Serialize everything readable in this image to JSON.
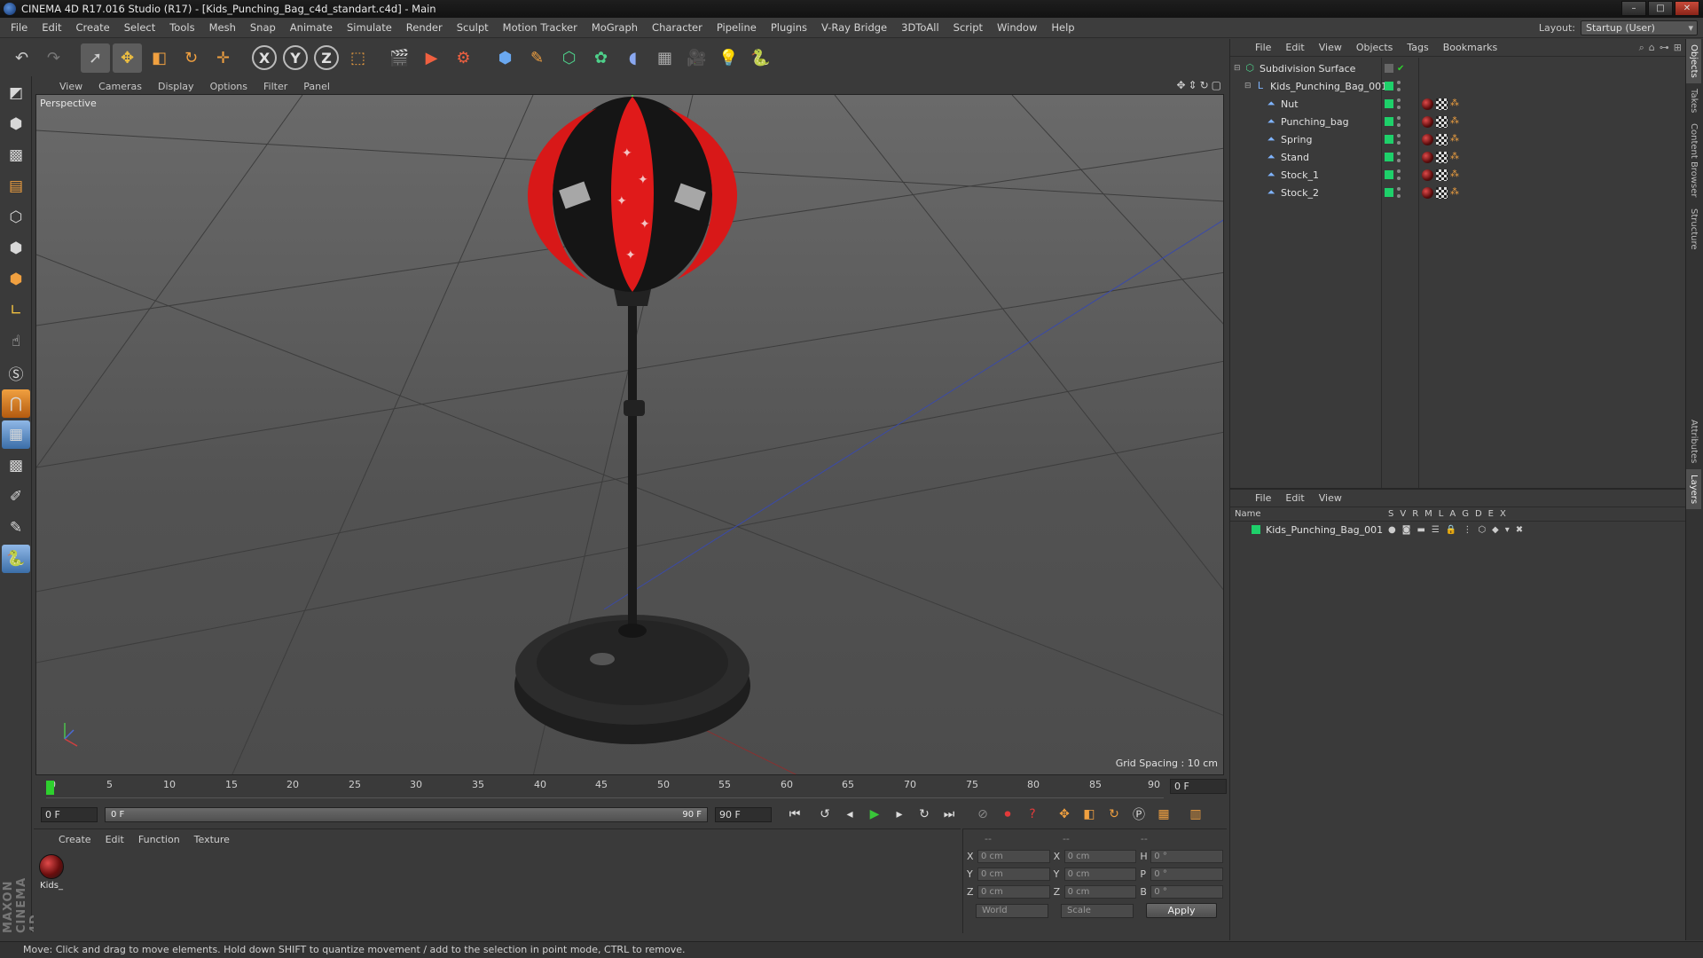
{
  "window": {
    "title": "CINEMA 4D R17.016 Studio (R17) - [Kids_Punching_Bag_c4d_standart.c4d] - Main"
  },
  "menubar": {
    "items": [
      "File",
      "Edit",
      "Create",
      "Select",
      "Tools",
      "Mesh",
      "Snap",
      "Animate",
      "Simulate",
      "Render",
      "Sculpt",
      "Motion Tracker",
      "MoGraph",
      "Character",
      "Pipeline",
      "Plugins",
      "V-Ray Bridge",
      "3DToAll",
      "Script",
      "Window",
      "Help"
    ],
    "layout_label": "Layout:",
    "layout_value": "Startup (User)"
  },
  "toolbar": {
    "axis_x": "X",
    "axis_y": "Y",
    "axis_z": "Z"
  },
  "viewport": {
    "menu": [
      "View",
      "Cameras",
      "Display",
      "Options",
      "Filter",
      "Panel"
    ],
    "camera_label": "Perspective",
    "grid_spacing": "Grid Spacing : 10 cm"
  },
  "timeline": {
    "ticks": [
      "0",
      "5",
      "10",
      "15",
      "20",
      "25",
      "30",
      "35",
      "40",
      "45",
      "50",
      "55",
      "60",
      "65",
      "70",
      "75",
      "80",
      "85",
      "90"
    ],
    "current_frame_right": "0 F"
  },
  "transport": {
    "start_field": "0 F",
    "range_start": "0 F",
    "range_end": "90 F",
    "end_field": "90 F"
  },
  "material_manager": {
    "menu": [
      "Create",
      "Edit",
      "Function",
      "Texture"
    ],
    "materials": [
      {
        "name": "Kids_"
      }
    ]
  },
  "coordinates": {
    "header": [
      "--",
      "--",
      "--"
    ],
    "rows": [
      {
        "l1": "X",
        "v1": "0 cm",
        "l2": "X",
        "v2": "0 cm",
        "l3": "H",
        "v3": "0 °"
      },
      {
        "l1": "Y",
        "v1": "0 cm",
        "l2": "Y",
        "v2": "0 cm",
        "l3": "P",
        "v3": "0 °"
      },
      {
        "l1": "Z",
        "v1": "0 cm",
        "l2": "Z",
        "v2": "0 cm",
        "l3": "B",
        "v3": "0 °"
      }
    ],
    "mode": "World",
    "scale": "Scale",
    "apply": "Apply"
  },
  "object_manager": {
    "menu": [
      "File",
      "Edit",
      "View",
      "Objects",
      "Tags",
      "Bookmarks"
    ],
    "objects": [
      {
        "name": "Subdivision Surface",
        "level": 0
      },
      {
        "name": "Kids_Punching_Bag_001",
        "level": 1
      },
      {
        "name": "Nut",
        "level": 2
      },
      {
        "name": "Punching_bag",
        "level": 2
      },
      {
        "name": "Spring",
        "level": 2
      },
      {
        "name": "Stand",
        "level": 2
      },
      {
        "name": "Stock_1",
        "level": 2
      },
      {
        "name": "Stock_2",
        "level": 2
      }
    ]
  },
  "layer_manager": {
    "menu": [
      "File",
      "Edit",
      "View"
    ],
    "col_name": "Name",
    "cols": [
      "S",
      "V",
      "R",
      "M",
      "L",
      "A",
      "G",
      "D",
      "E",
      "X"
    ],
    "layers": [
      {
        "name": "Kids_Punching_Bag_001"
      }
    ]
  },
  "side_tabs": [
    "Objects",
    "Takes",
    "Content Browser",
    "Structure",
    "Attributes",
    "Layers"
  ],
  "status": {
    "text": "Move: Click and drag to move elements. Hold down SHIFT to quantize movement / add to the selection in point mode, CTRL to remove."
  },
  "colors": {
    "layer_green": "#1ed06a",
    "accent_blue": "#7fb4ff",
    "play_green": "#39c639"
  }
}
